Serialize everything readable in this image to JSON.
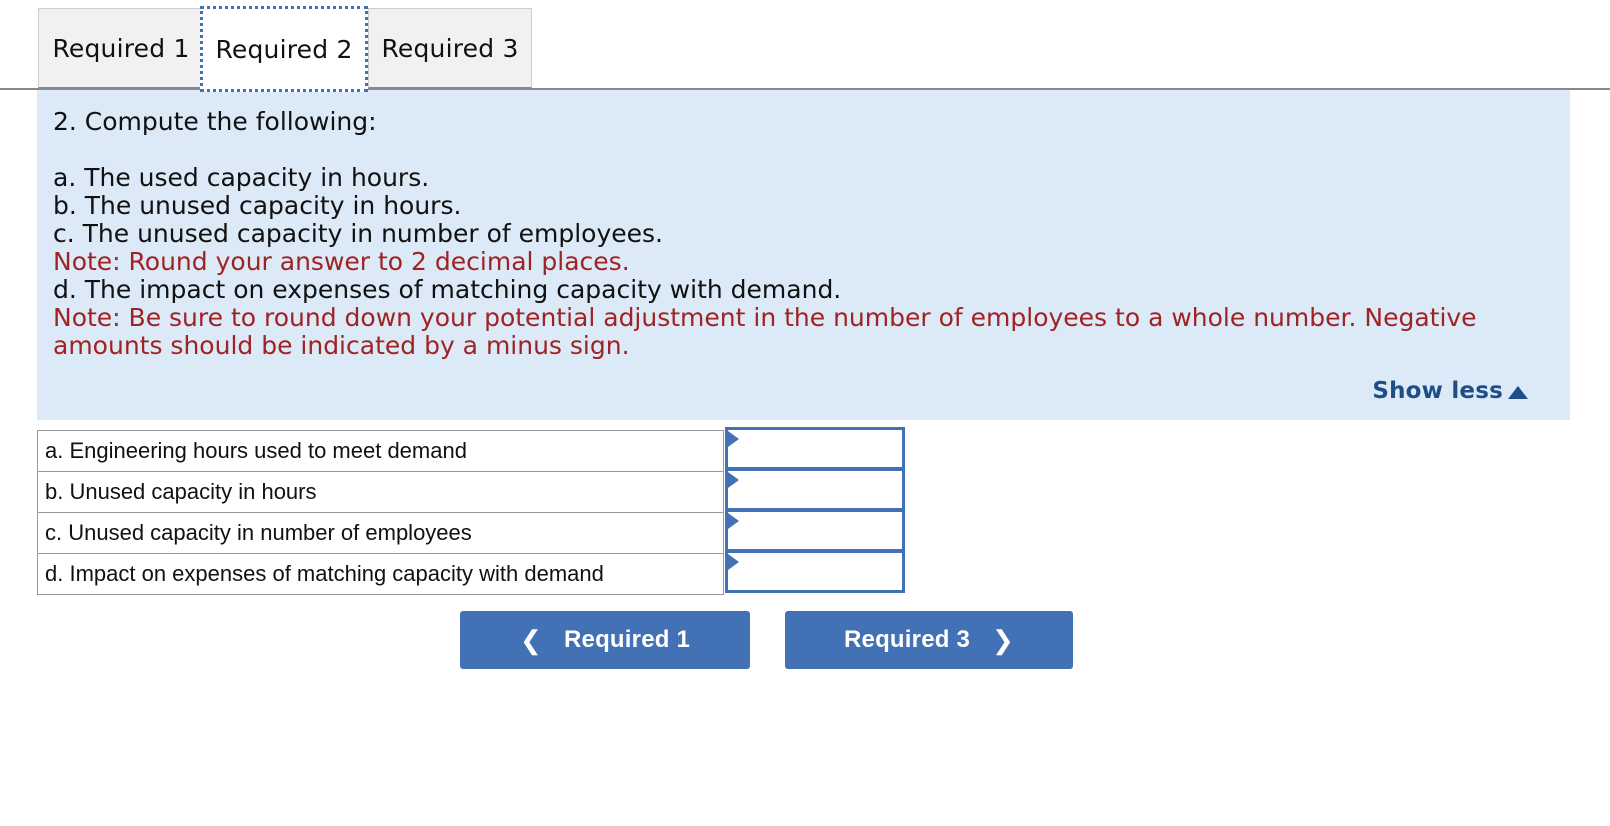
{
  "tabs": [
    {
      "label": "Required 1",
      "active": false
    },
    {
      "label": "Required 2",
      "active": true
    },
    {
      "label": "Required 3",
      "active": false
    }
  ],
  "instructions": {
    "heading": "2. Compute the following:",
    "lines": [
      {
        "text": "a. The used capacity in hours.",
        "red": false
      },
      {
        "text": "b. The unused capacity in hours.",
        "red": false
      },
      {
        "text": "c. The unused capacity in number of employees.",
        "red": false
      },
      {
        "text": "Note: Round your answer to 2 decimal places.",
        "red": true
      },
      {
        "text": "d. The impact on expenses of matching capacity with demand.",
        "red": false
      },
      {
        "text": "Note: Be sure to round down your potential adjustment in the number of employees to a whole number. Negative amounts should be indicated by a minus sign.",
        "red": true
      }
    ],
    "show_less_label": "Show less",
    "show_less_icon": "caret-up-icon"
  },
  "answer_rows": [
    {
      "label": "a. Engineering hours used to meet demand",
      "value": "",
      "placeholder": ""
    },
    {
      "label": "b. Unused capacity in hours",
      "value": "",
      "placeholder": ""
    },
    {
      "label": "c. Unused capacity in number of employees",
      "value": "",
      "placeholder": ""
    },
    {
      "label": "d. Impact on expenses of matching capacity with demand",
      "value": "",
      "placeholder": ""
    }
  ],
  "nav": {
    "prev_label": "Required 1",
    "prev_icon": "chevron-left-icon",
    "next_label": "Required 3",
    "next_icon": "chevron-right-icon"
  },
  "colors": {
    "panel_background": "#dce9f7",
    "note_red": "#a02323",
    "accent_blue": "#4272b5",
    "link_blue": "#1f4e87",
    "tab_inactive": "#f1f1f1"
  }
}
